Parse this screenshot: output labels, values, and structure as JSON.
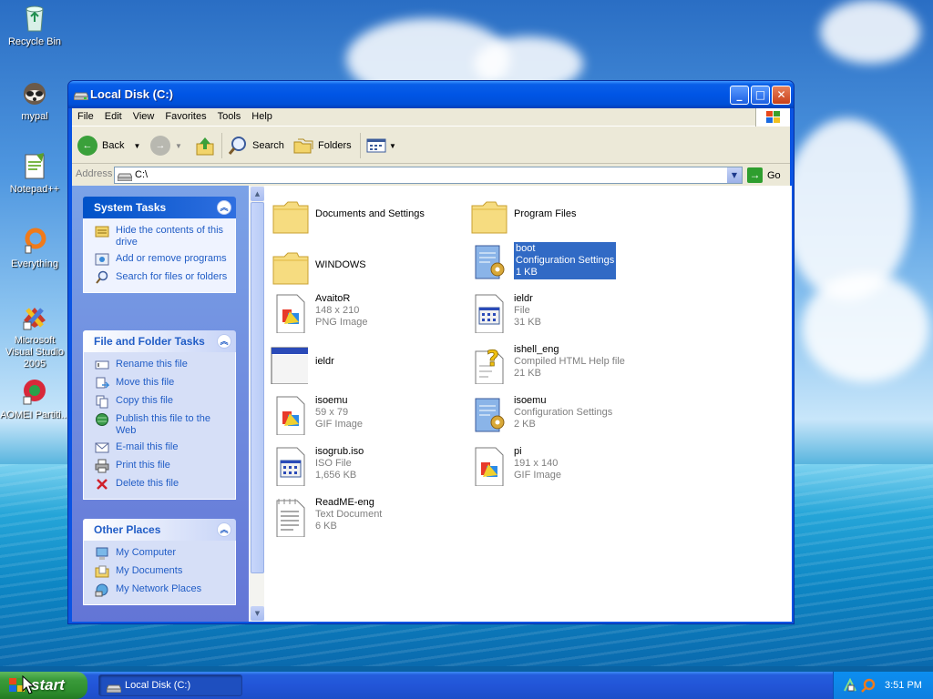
{
  "desktop": {
    "icons": [
      {
        "label": "Recycle Bin",
        "icon": "recycle-bin-icon"
      },
      {
        "label": "mypal",
        "icon": "raccoon-icon"
      },
      {
        "label": "Notepad++",
        "icon": "notepad-icon"
      },
      {
        "label": "Everything",
        "icon": "magnifier-icon"
      },
      {
        "label": "Microsoft Visual Studio 2005",
        "icon": "visual-studio-icon"
      },
      {
        "label": "AOMEI Partiti...",
        "icon": "aomei-icon"
      }
    ]
  },
  "window": {
    "title": "Local Disk (C:)",
    "menu": [
      "File",
      "Edit",
      "View",
      "Favorites",
      "Tools",
      "Help"
    ],
    "toolbar": {
      "back": "Back",
      "search": "Search",
      "folders": "Folders"
    },
    "address": {
      "label": "Address",
      "value": "C:\\",
      "go": "Go"
    }
  },
  "sidebar": {
    "system_tasks": {
      "title": "System Tasks",
      "items": [
        "Hide the contents of this drive",
        "Add or remove programs",
        "Search for files or folders"
      ]
    },
    "file_tasks": {
      "title": "File and Folder Tasks",
      "items": [
        "Rename this file",
        "Move this file",
        "Copy this file",
        "Publish this file to the Web",
        "E-mail this file",
        "Print this file",
        "Delete this file"
      ]
    },
    "other_places": {
      "title": "Other Places",
      "items": [
        "My Computer",
        "My Documents",
        "My Network Places"
      ]
    }
  },
  "files": [
    {
      "name": "Documents and Settings",
      "type": "folder"
    },
    {
      "name": "Program Files",
      "type": "folder"
    },
    {
      "name": "WINDOWS",
      "type": "folder"
    },
    {
      "name": "boot",
      "line2": "Configuration Settings",
      "line3": "1 KB",
      "type": "config",
      "selected": true
    },
    {
      "name": "AvaitoR",
      "line2": "148 x 210",
      "line3": "PNG Image",
      "type": "image"
    },
    {
      "name": "ieldr",
      "line2": "File",
      "line3": "31 KB",
      "type": "binary"
    },
    {
      "name": "ieldr",
      "type": "app"
    },
    {
      "name": "ishell_eng",
      "line2": "Compiled HTML Help file",
      "line3": "21 KB",
      "type": "help"
    },
    {
      "name": "isoemu",
      "line2": "59 x 79",
      "line3": "GIF Image",
      "type": "image"
    },
    {
      "name": "isoemu",
      "line2": "Configuration Settings",
      "line3": "2 KB",
      "type": "config"
    },
    {
      "name": "isogrub.iso",
      "line2": "ISO File",
      "line3": "1,656 KB",
      "type": "binary"
    },
    {
      "name": "pi",
      "line2": "191 x 140",
      "line3": "GIF Image",
      "type": "image"
    },
    {
      "name": "ReadME-eng",
      "line2": "Text Document",
      "line3": "6 KB",
      "type": "text"
    }
  ],
  "taskbar": {
    "start": "start",
    "task": "Local Disk (C:)",
    "clock": "3:51 PM"
  },
  "colors": {
    "title_blue": "#0055e5",
    "selection": "#316ac5",
    "link_blue": "#215dc6",
    "start_green": "#3a9a3a"
  }
}
